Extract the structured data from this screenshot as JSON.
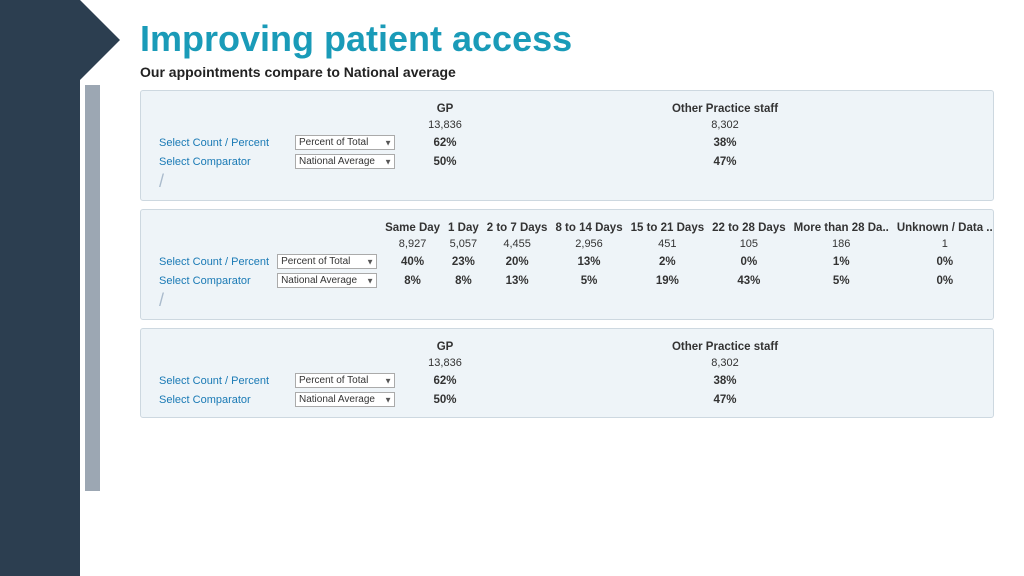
{
  "title": "Improving patient access",
  "subtitle": "Our appointments compare to National average",
  "panel1": {
    "cols": [
      "",
      "",
      "GP",
      "",
      "",
      "",
      "Other Practice staff",
      ""
    ],
    "count_row": [
      "",
      "",
      "13,836",
      "",
      "",
      "",
      "8,302",
      ""
    ],
    "select_count_label": "Select Count / Percent",
    "select_comparator_label": "Select Comparator",
    "select_count_options": [
      "Percent of Total"
    ],
    "select_comparator_options": [
      "National Average"
    ],
    "percent_row": [
      "62%",
      "38%"
    ],
    "comparator_row": [
      "50%",
      "47%"
    ]
  },
  "panel2": {
    "cols": [
      "Same Day",
      "1 Day",
      "2 to 7 Days",
      "8  to 14 Days",
      "15  to 21 Days",
      "22  to 28 Days",
      "More than 28 Da..",
      "Unknown / Data .."
    ],
    "count_row": [
      "8,927",
      "5,057",
      "4,455",
      "2,956",
      "451",
      "105",
      "186",
      "1"
    ],
    "select_count_label": "Select Count  / Percent",
    "select_comparator_label": "Select Comparator",
    "select_count_options": [
      "Percent of Total"
    ],
    "select_comparator_options": [
      "National Average"
    ],
    "percent_row": [
      "40%",
      "23%",
      "20%",
      "13%",
      "2%",
      "0%",
      "1%",
      "0%"
    ],
    "comparator_row": [
      "8%",
      "8%",
      "13%",
      "5%",
      "19%",
      "43%",
      "5%",
      "0%"
    ]
  },
  "panel3": {
    "cols": [
      "",
      "",
      "GP",
      "",
      "",
      "",
      "Other Practice staff",
      ""
    ],
    "count_row": [
      "",
      "",
      "13,836",
      "",
      "",
      "",
      "8,302",
      ""
    ],
    "select_count_label": "Select Count / Percent",
    "select_comparator_label": "Select Comparator",
    "select_count_options": [
      "Percent of Total"
    ],
    "select_comparator_options": [
      "National Average"
    ],
    "percent_row": [
      "62%",
      "38%"
    ],
    "comparator_row": [
      "50%",
      "47%"
    ]
  },
  "dropdowns": {
    "percent_of_total": "Percent of Total",
    "national_average": "National Average"
  }
}
